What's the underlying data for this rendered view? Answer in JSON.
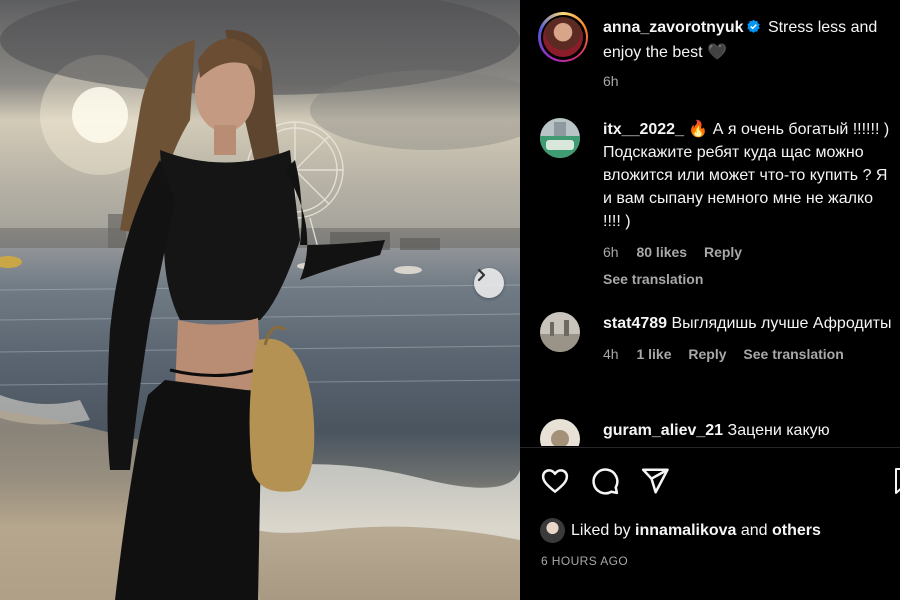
{
  "post": {
    "username": "anna_zavorotnyuk",
    "caption": "Stress less and enjoy the best 🖤",
    "time_ago": "6h",
    "liked_by_prefix": "Liked by",
    "liked_by_user": "innamalikova",
    "liked_by_and": "and",
    "liked_by_others": "others",
    "timestamp": "6 HOURS AGO"
  },
  "comments": [
    {
      "username": "itx__2022_",
      "text": "🔥 А я очень богатый !!!!!! ) Подскажите ребят куда щас можно вложится или может что-то купить ? Я и вам сыпану немного мне не жалко !!!! )",
      "time": "6h",
      "likes": "80 likes",
      "reply": "Reply",
      "extra": "See translation"
    },
    {
      "username": "stat4789",
      "text": "Выглядишь лучше Афродиты",
      "time": "4h",
      "likes": "1 like",
      "reply": "Reply",
      "extra": "See translation"
    },
    {
      "username": "guram_aliev_21",
      "text": "Зацени какую"
    }
  ],
  "icons": {
    "verified": "verified-badge-icon",
    "next": "chevron-right-icon",
    "like": "heart-icon",
    "comment": "comment-bubble-icon",
    "share": "paper-plane-icon",
    "save": "bookmark-icon"
  },
  "colors": {
    "verified_blue": "#0095f6",
    "secondary_text": "#a8a8a8"
  }
}
